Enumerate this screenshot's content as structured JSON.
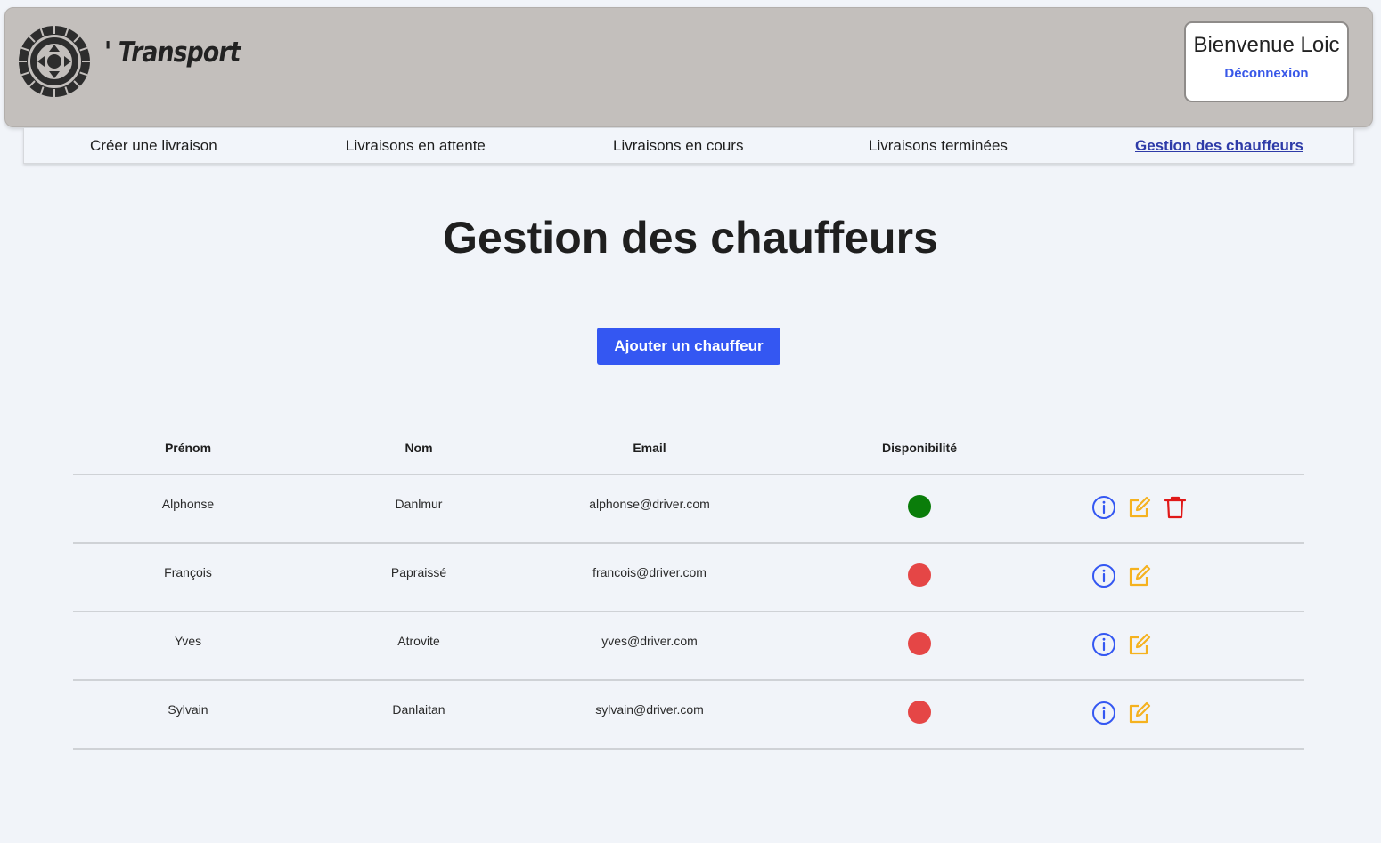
{
  "header": {
    "logo_text": "' Transport",
    "welcome": "Bienvenue Loic",
    "logout": "Déconnexion"
  },
  "nav": {
    "items": [
      {
        "label": "Créer une livraison",
        "active": false
      },
      {
        "label": "Livraisons en attente",
        "active": false
      },
      {
        "label": "Livraisons en cours",
        "active": false
      },
      {
        "label": "Livraisons terminées",
        "active": false
      },
      {
        "label": "Gestion des chauffeurs",
        "active": true
      }
    ]
  },
  "main": {
    "title": "Gestion des chauffeurs",
    "add_button": "Ajouter un chauffeur"
  },
  "table": {
    "headers": {
      "firstname": "Prénom",
      "lastname": "Nom",
      "email": "Email",
      "availability": "Disponibilité"
    },
    "rows": [
      {
        "firstname": "Alphonse",
        "lastname": "Danlmur",
        "email": "alphonse@driver.com",
        "available": true,
        "actions": [
          "info-icon",
          "edit-icon",
          "trash-icon"
        ]
      },
      {
        "firstname": "François",
        "lastname": "Papraissé",
        "email": "francois@driver.com",
        "available": false,
        "actions": [
          "info-icon",
          "edit-icon"
        ]
      },
      {
        "firstname": "Yves",
        "lastname": "Atrovite",
        "email": "yves@driver.com",
        "available": false,
        "actions": [
          "info-icon",
          "edit-icon"
        ]
      },
      {
        "firstname": "Sylvain",
        "lastname": "Danlaitan",
        "email": "sylvain@driver.com",
        "available": false,
        "actions": [
          "info-icon",
          "edit-icon"
        ]
      }
    ]
  },
  "colors": {
    "header_bg": "#c3bfbc",
    "page_bg": "#f1f4f9",
    "primary": "#3457f2",
    "available": "#0a7d0a",
    "unavailable": "#e54646",
    "info_icon": "#3457f2",
    "edit_icon": "#f5b21f",
    "delete_icon": "#e01818"
  }
}
